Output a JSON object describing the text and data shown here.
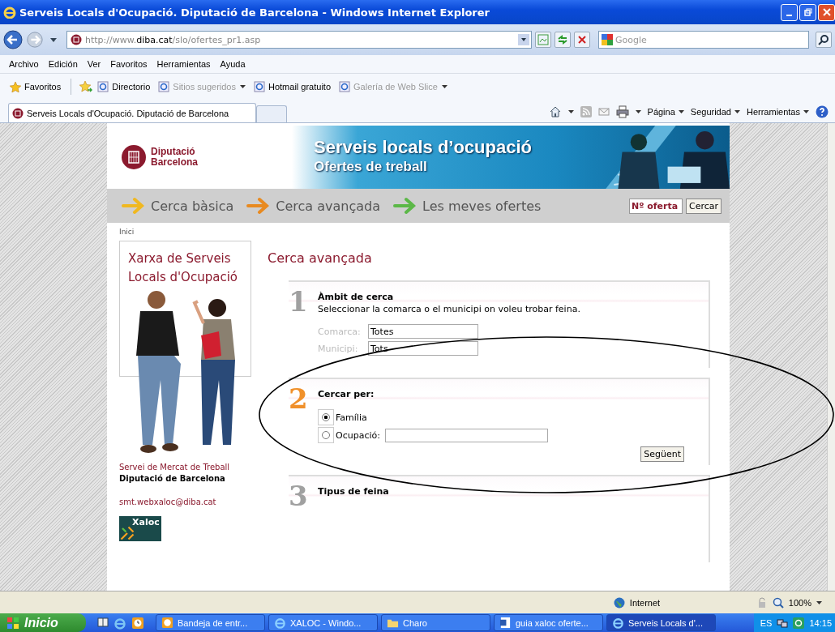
{
  "window": {
    "title": "Serveis Locals d'Ocupació. Diputació de Barcelona - Windows Internet Explorer"
  },
  "address": {
    "url": "http://www.**diba.cat**/slo/ofertes_pr1.asp"
  },
  "search": {
    "placeholder": "Google"
  },
  "menu": [
    "Archivo",
    "Edición",
    "Ver",
    "Favoritos",
    "Herramientas",
    "Ayuda"
  ],
  "favorites_bar": {
    "label": "Favoritos",
    "links": [
      {
        "label": "Directorio",
        "disabled": false,
        "dropdown": false
      },
      {
        "label": "Sitios sugeridos",
        "disabled": true,
        "dropdown": true
      },
      {
        "label": "Hotmail gratuito",
        "disabled": false,
        "dropdown": false
      },
      {
        "label": "Galería de Web Slice",
        "disabled": true,
        "dropdown": true
      }
    ]
  },
  "tab": {
    "title": "Serveis Locals d'Ocupació. Diputació de Barcelona"
  },
  "command_bar": [
    "Página",
    "Seguridad",
    "Herramientas"
  ],
  "page": {
    "logo": [
      "Diputació",
      "Barcelona"
    ],
    "banner_title": "Serveis locals d’ocupació",
    "banner_subtitle": "Ofertes de treball",
    "nav": [
      {
        "label": "Cerca bàsica",
        "color": "#f0b820"
      },
      {
        "label": "Cerca avançada",
        "color": "#e88a20"
      },
      {
        "label": "Les meves ofertes",
        "color": "#5cb848"
      }
    ],
    "offer_field": {
      "value": "Nº oferta"
    },
    "search_button": "Cercar",
    "breadcrumb": "Inici",
    "sidebar": {
      "title": "Xarxa de Serveis Locals d'Ocupació",
      "org": "Servei de Mercat de Treball",
      "org_bold": "Diputació de Barcelona",
      "email": "smt.webxaloc@diba.cat",
      "badge": "Xaloc"
    },
    "heading": "Cerca avançada",
    "steps": [
      {
        "number": "1",
        "color": "#a0a0a0",
        "title": "Àmbit de cerca",
        "kind": "fields",
        "description": "Seleccionar la comarca o el municipi on voleu trobar feina.",
        "fields": [
          {
            "label": "Comarca:",
            "value": "Totes"
          },
          {
            "label": "Municipi:",
            "value": "Tots"
          }
        ]
      },
      {
        "number": "2",
        "color": "#f0902a",
        "title": "Cercar per:",
        "kind": "radios",
        "options": [
          {
            "label": "Família",
            "selected": true,
            "has_field": false
          },
          {
            "label": "Ocupació:",
            "selected": false,
            "has_field": true
          }
        ],
        "button": "Següent"
      },
      {
        "number": "3",
        "color": "#a0a0a0",
        "title": "Tipus de feina",
        "kind": "empty"
      }
    ]
  },
  "status_bar": {
    "zone": "Internet",
    "zoom": "100%"
  },
  "taskbar": {
    "start": "Inicio",
    "tasks": [
      {
        "label": "Bandeja de entr...",
        "selected": false
      },
      {
        "label": "XALOC - Windo...",
        "selected": false
      },
      {
        "label": "Charo",
        "selected": false
      },
      {
        "label": "guia xaloc oferte...",
        "selected": false
      },
      {
        "label": "Serveis Locals d'...",
        "selected": true
      }
    ],
    "language": "ES",
    "clock": "14:15"
  }
}
